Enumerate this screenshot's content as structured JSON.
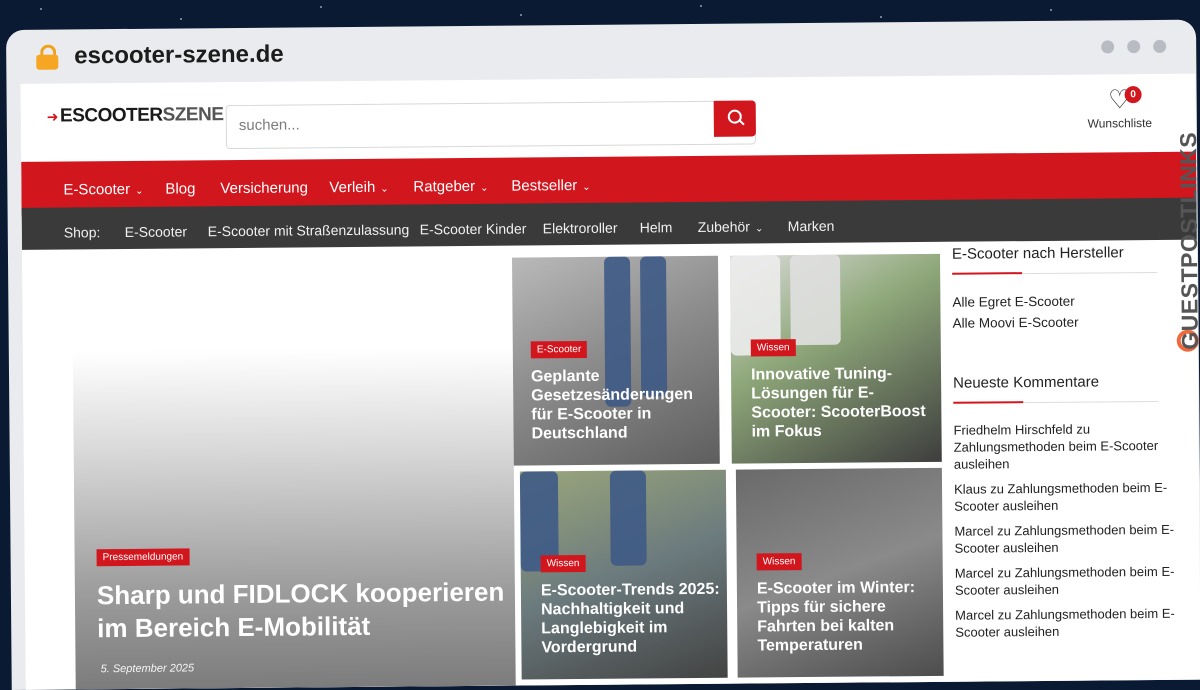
{
  "browser": {
    "url": "escooter-szene.de"
  },
  "logo": {
    "part1": "ESCOOTER",
    "part2": "SZENE"
  },
  "search": {
    "placeholder": "suchen..."
  },
  "wishlist": {
    "count": "0",
    "label": "Wunschliste"
  },
  "main_nav": [
    {
      "label": "E-Scooter",
      "has_dropdown": true
    },
    {
      "label": "Blog",
      "has_dropdown": false
    },
    {
      "label": "Versicherung",
      "has_dropdown": false
    },
    {
      "label": "Verleih",
      "has_dropdown": true
    },
    {
      "label": "Ratgeber",
      "has_dropdown": true
    },
    {
      "label": "Bestseller",
      "has_dropdown": true
    }
  ],
  "sub_nav": [
    {
      "label": "Shop:"
    },
    {
      "label": "E-Scooter"
    },
    {
      "label": "E-Scooter mit Straßenzulassung"
    },
    {
      "label": "E-Scooter Kinder"
    },
    {
      "label": "Elektroroller"
    },
    {
      "label": "Helm"
    },
    {
      "label": "Zubehör",
      "has_dropdown": true
    },
    {
      "label": "Marken"
    }
  ],
  "hero": {
    "tag": "Pressemeldungen",
    "title": "Sharp und FIDLOCK kooperieren im Bereich E-Mobilität",
    "date": "5. September 2025"
  },
  "cards": [
    {
      "tag": "E-Scooter",
      "title": "Geplante Gesetzesänderungen für E-Scooter in Deutschland"
    },
    {
      "tag": "Wissen",
      "title": "Innovative Tuning-Lösungen für E-Scooter: ScooterBoost im Fokus"
    },
    {
      "tag": "Wissen",
      "title": "E-Scooter-Trends 2025: Nachhaltigkeit und Langlebigkeit im Vordergrund"
    },
    {
      "tag": "Wissen",
      "title": "E-Scooter im Winter: Tipps für sichere Fahrten bei kalten Temperaturen"
    }
  ],
  "sidebar": {
    "manufacturers_title": "E-Scooter nach Hersteller",
    "manufacturers": [
      "Alle Egret E-Scooter",
      "Alle Moovi E-Scooter"
    ],
    "comments_title": "Neueste Kommentare",
    "comments": [
      "Friedhelm Hirschfeld zu Zahlungsmethoden beim E-Scooter ausleihen",
      "Klaus zu Zahlungsmethoden beim E-Scooter ausleihen",
      "Marcel zu Zahlungsmethoden beim E-Scooter ausleihen",
      "Marcel zu Zahlungsmethoden beim E-Scooter ausleihen",
      "Marcel zu Zahlungsmethoden beim E-Scooter ausleihen"
    ]
  },
  "watermark": {
    "text": "GUESTPOSTLINKS"
  },
  "colors": {
    "accent": "#d2161e",
    "subnav": "#3a3a3a",
    "chrome": "#e9ebee",
    "watermark": "#ee6a3c"
  }
}
